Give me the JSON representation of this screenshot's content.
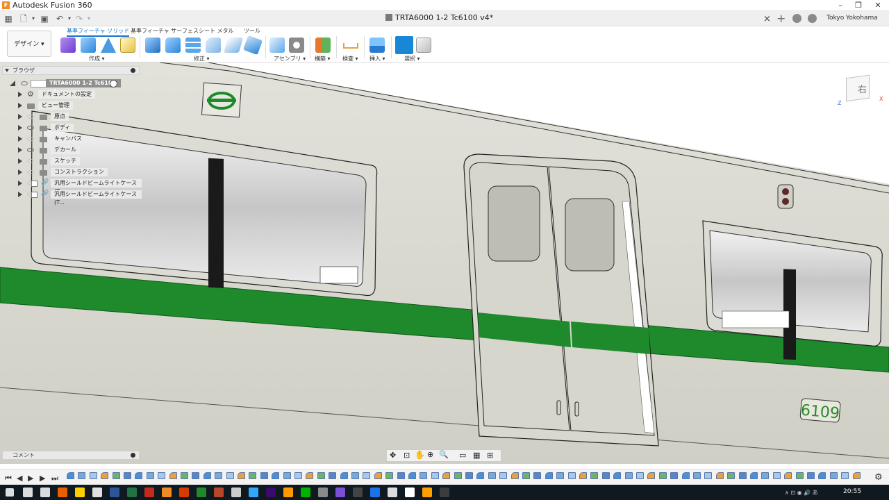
{
  "window": {
    "title": "Autodesk Fusion 360",
    "app_icon_letter": "F"
  },
  "document_tab": {
    "title": "TRTA6000 1-2 Tc6100 v4*"
  },
  "user": {
    "name": "Tokyo Yokohama"
  },
  "ribbon": {
    "workspace_button": "デザイン ▾",
    "tabs": [
      "基準フィーチャ ソリッド",
      "基準フィーチャ サーフェス",
      "シート メタル",
      "ツール"
    ],
    "active_tab": 0,
    "groups": [
      "作成 ▾",
      "修正 ▾",
      "アセンブリ ▾",
      "構築 ▾",
      "検査 ▾",
      "挿入 ▾",
      "選択 ▾"
    ]
  },
  "browser": {
    "header": "ブラウザ",
    "root": "TRTA6000 1-2 Tc6100 v4",
    "items": [
      {
        "label": "ドキュメントの設定",
        "icon": "gear-icon"
      },
      {
        "label": "ビュー管理",
        "icon": "folder-icon"
      },
      {
        "label": "原点",
        "icon": "folder-icon"
      },
      {
        "label": "ボディ",
        "icon": "folder-icon"
      },
      {
        "label": "キャンバス",
        "icon": "folder-icon"
      },
      {
        "label": "デカール",
        "icon": "folder-icon"
      },
      {
        "label": "スケッチ",
        "icon": "folder-icon"
      },
      {
        "label": "コンストラクション",
        "icon": "folder-icon"
      },
      {
        "label": "汎用シールドビームライトケース(T...",
        "icon": "link-icon"
      },
      {
        "label": "汎用シールドビームライトケース(T...",
        "icon": "link-icon"
      }
    ]
  },
  "comments": {
    "header": "コメント"
  },
  "viewcube": {
    "face_label": "右",
    "axis_x": "X",
    "axis_z": "Z"
  },
  "model": {
    "car_number": "6109"
  },
  "colors": {
    "accent": "#1a73c9",
    "stripe_green": "#1e8a2c",
    "car_body": "#d9d9cf"
  },
  "taskbar": {
    "time": "20:55"
  }
}
